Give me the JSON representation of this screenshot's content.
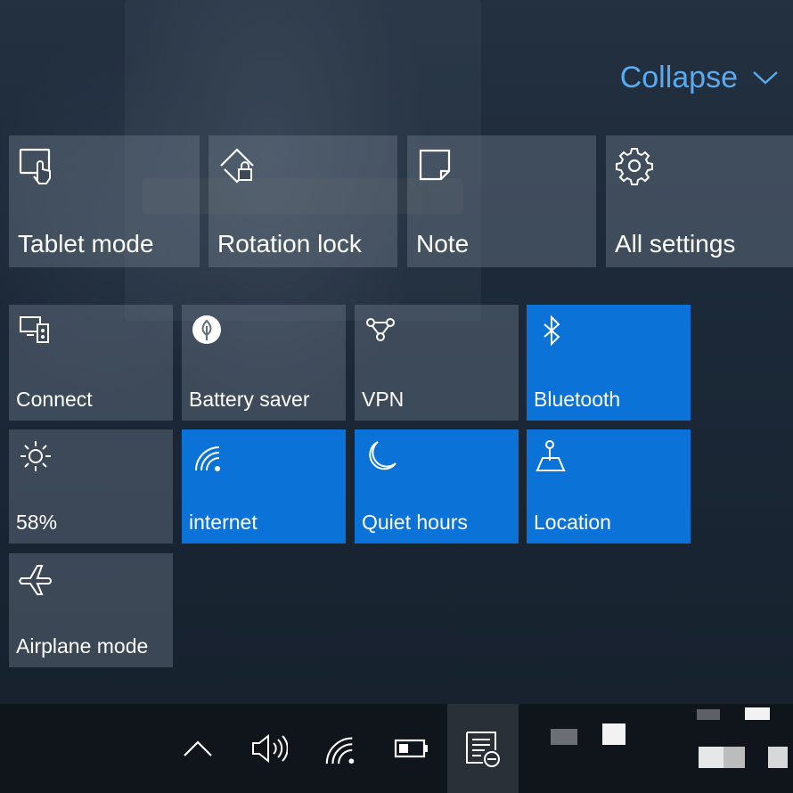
{
  "header": {
    "collapse_label": "Collapse"
  },
  "tiles_top": [
    {
      "label": "Tablet mode",
      "icon": "tablet-mode-icon",
      "on": false
    },
    {
      "label": "Rotation lock",
      "icon": "rotation-lock-icon",
      "on": false
    },
    {
      "label": "Note",
      "icon": "note-icon",
      "on": false
    },
    {
      "label": "All settings",
      "icon": "gear-icon",
      "on": false
    }
  ],
  "tiles_grid": [
    {
      "label": "Connect",
      "icon": "connect-icon",
      "on": false
    },
    {
      "label": "Battery saver",
      "icon": "battery-saver-icon",
      "on": false
    },
    {
      "label": "VPN",
      "icon": "vpn-icon",
      "on": false
    },
    {
      "label": "Bluetooth",
      "icon": "bluetooth-icon",
      "on": true
    },
    {
      "label": "58%",
      "icon": "brightness-icon",
      "on": false
    },
    {
      "label": "internet",
      "icon": "wifi-icon",
      "on": true
    },
    {
      "label": "Quiet hours",
      "icon": "moon-icon",
      "on": true
    },
    {
      "label": "Location",
      "icon": "location-icon",
      "on": true
    },
    {
      "label": "Airplane mode",
      "icon": "airplane-icon",
      "on": false
    }
  ],
  "taskbar": {
    "icons": [
      "chevron-up-icon",
      "volume-icon",
      "wifi-icon",
      "battery-icon",
      "action-center-icon"
    ]
  },
  "colors": {
    "accent_on": "#0b73d8",
    "tile_off": "#5f6d7c",
    "collapse_text": "#5aaaf0",
    "taskbar": "#10151b"
  }
}
